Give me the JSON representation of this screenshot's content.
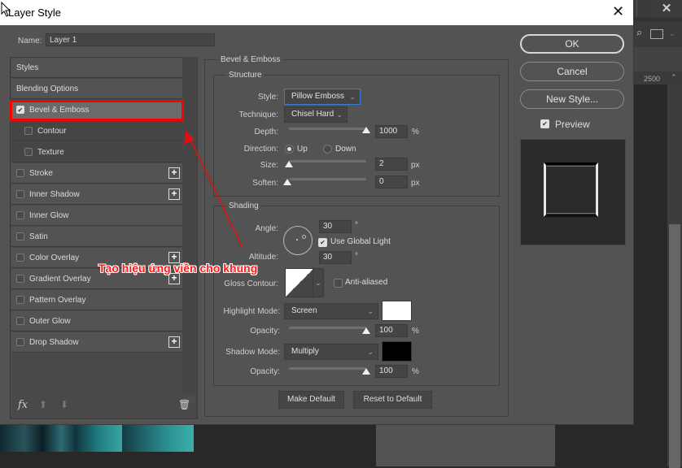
{
  "dialog": {
    "title": "Layer Style",
    "name_label": "Name:",
    "name_value": "Layer 1"
  },
  "styles_list": {
    "header": "Styles",
    "blending": "Blending Options",
    "items": [
      {
        "label": "Bevel & Emboss",
        "checked": true,
        "sub": false,
        "plus": false,
        "selected": true
      },
      {
        "label": "Contour",
        "checked": false,
        "sub": true,
        "plus": false
      },
      {
        "label": "Texture",
        "checked": false,
        "sub": true,
        "plus": false
      },
      {
        "label": "Stroke",
        "checked": false,
        "sub": false,
        "plus": true
      },
      {
        "label": "Inner Shadow",
        "checked": false,
        "sub": false,
        "plus": true
      },
      {
        "label": "Inner Glow",
        "checked": false,
        "sub": false,
        "plus": false
      },
      {
        "label": "Satin",
        "checked": false,
        "sub": false,
        "plus": false
      },
      {
        "label": "Color Overlay",
        "checked": false,
        "sub": false,
        "plus": true
      },
      {
        "label": "Gradient Overlay",
        "checked": false,
        "sub": false,
        "plus": true
      },
      {
        "label": "Pattern Overlay",
        "checked": false,
        "sub": false,
        "plus": false
      },
      {
        "label": "Outer Glow",
        "checked": false,
        "sub": false,
        "plus": false
      },
      {
        "label": "Drop Shadow",
        "checked": false,
        "sub": false,
        "plus": true
      }
    ],
    "fx_label": "fx"
  },
  "bevel": {
    "group_title": "Bevel & Emboss",
    "structure": {
      "title": "Structure",
      "style_label": "Style:",
      "style_value": "Pillow Emboss",
      "technique_label": "Technique:",
      "technique_value": "Chisel Hard",
      "depth_label": "Depth:",
      "depth_value": "1000",
      "depth_unit": "%",
      "depth_fraction": 1.0,
      "direction_label": "Direction:",
      "direction_up": "Up",
      "direction_down": "Down",
      "direction_selected": "Up",
      "size_label": "Size:",
      "size_value": "2",
      "size_unit": "px",
      "size_fraction": 0.0,
      "soften_label": "Soften:",
      "soften_value": "0",
      "soften_unit": "px",
      "soften_fraction": 0.0
    },
    "shading": {
      "title": "Shading",
      "angle_label": "Angle:",
      "angle_value": "30",
      "degree": "°",
      "global_light_label": "Use Global Light",
      "global_light": true,
      "altitude_label": "Altitude:",
      "altitude_value": "30",
      "gloss_label": "Gloss Contour:",
      "anti_aliased_label": "Anti-aliased",
      "anti_aliased": false,
      "highlight_label": "Highlight Mode:",
      "highlight_value": "Screen",
      "highlight_color": "#ffffff",
      "hl_opacity_label": "Opacity:",
      "hl_opacity_value": "100",
      "hl_opacity_fraction": 1.0,
      "shadow_label": "Shadow Mode:",
      "shadow_value": "Multiply",
      "shadow_color": "#000000",
      "sh_opacity_label": "Opacity:",
      "sh_opacity_value": "100",
      "sh_opacity_fraction": 1.0,
      "percent": "%"
    },
    "make_default": "Make Default",
    "reset_default": "Reset to Default"
  },
  "right": {
    "ok": "OK",
    "cancel": "Cancel",
    "new_style": "New Style...",
    "preview_label": "Preview",
    "preview_checked": true
  },
  "annotation": {
    "text": "Tạo hiệu ứng viền cho khung",
    "color": "#ff1a1a"
  },
  "background_app": {
    "ruler_number": "2500"
  }
}
